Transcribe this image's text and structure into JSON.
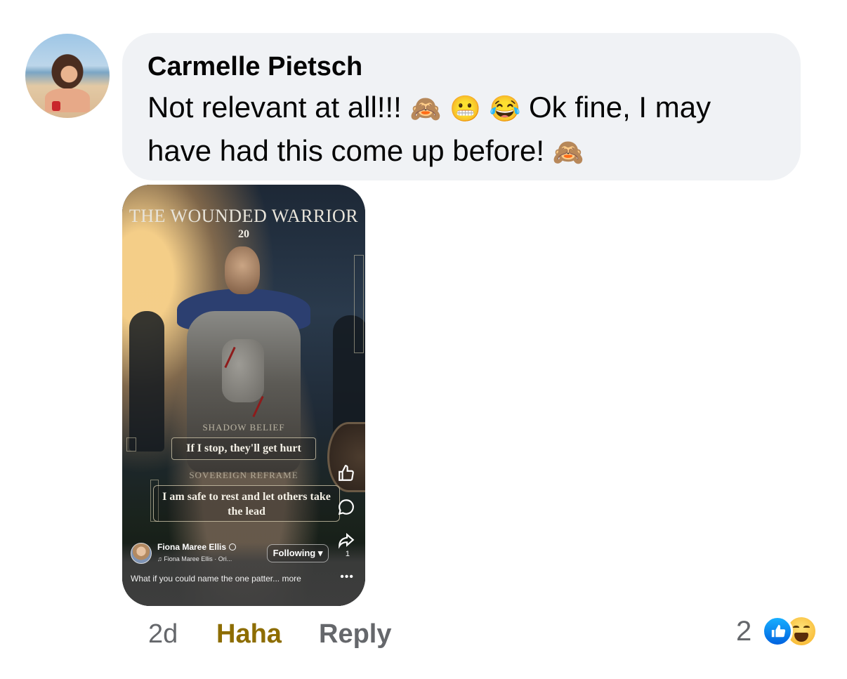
{
  "comment": {
    "author": "Carmelle Pietsch",
    "text_parts": [
      "Not relevant at all!!! ",
      "🙈",
      "😬",
      "😂",
      " Ok fine, I may have had this come up before! ",
      "🙈"
    ],
    "time": "2d",
    "reaction_button": "Haha",
    "reply_label": "Reply",
    "reaction_count": "2",
    "reaction_icons": [
      "like-icon",
      "haha-icon"
    ]
  },
  "reel": {
    "title": "THE WOUNDED WARRIOR",
    "number": "20",
    "shadow_label": "SHADOW BELIEF",
    "belief": "If I stop, they'll get hurt",
    "reframe_label": "SOVEREIGN REFRAME",
    "reframe": "I am safe to rest and let others take the lead",
    "creator": "Fiona Maree Ellis",
    "audio": "Fiona Maree Ellis · Ori...",
    "follow_label": "Following",
    "share_count": "1",
    "caption": "What if you could name the one patter... more",
    "more_dots": "•••"
  },
  "colors": {
    "bubble_bg": "#f0f2f5",
    "muted_text": "#65676b",
    "haha_active": "#8d6d00",
    "like_blue": "#0866ff"
  }
}
